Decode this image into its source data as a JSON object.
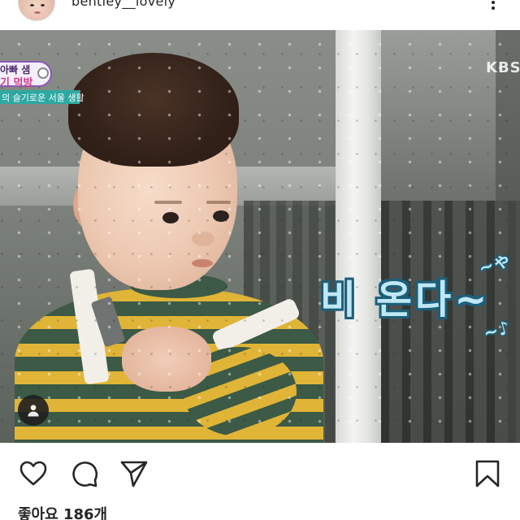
{
  "header": {
    "username": "bentley__lovely",
    "avatar_icon": "profile-avatar",
    "more_icon": "more-dots-icon"
  },
  "post": {
    "overlay": {
      "caption_line1": "아빠 샘",
      "caption_line2": "기 먹방",
      "subtitle": "의 슬기로운 서울 생활",
      "channel_logo": "KBS",
      "rain_text": "비 온다~",
      "squiggle1": "~ゃ",
      "squiggle2": "~♪"
    },
    "user_tag_icon": "user-tag-icon"
  },
  "actions": {
    "like_icon": "heart-icon",
    "comment_icon": "comment-icon",
    "share_icon": "send-icon",
    "save_icon": "bookmark-icon"
  },
  "likes": {
    "text": "좋아요 186개"
  }
}
